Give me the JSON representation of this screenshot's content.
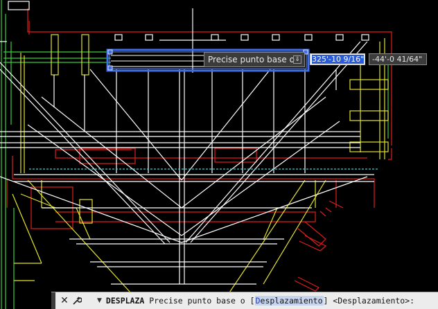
{
  "drawing": {
    "colors": {
      "background": "#000000",
      "white": "#ffffff",
      "yellow": "#e6e62e",
      "red": "#e01e1e",
      "green": "#3ad23a",
      "cyan": "#38d0e0",
      "selection": "#3f6fe8"
    }
  },
  "tooltip": {
    "prompt": "Precise punto base o",
    "menu_icon": "download-arrow-icon"
  },
  "dynamic_input": {
    "field1_value": "325'-10 9/16\"",
    "field2_value": "-44'-0 41/64\""
  },
  "command_line": {
    "close_icon": "close-icon",
    "customize_icon": "wrench-icon",
    "recent_icon": "dropdown-arrow-icon",
    "command": "DESPLAZA",
    "prompt": "Precise punto base o [",
    "keyword_first": "D",
    "keyword_rest": "esplazamiento",
    "prompt_tail": "] <Desplazamiento>:"
  }
}
